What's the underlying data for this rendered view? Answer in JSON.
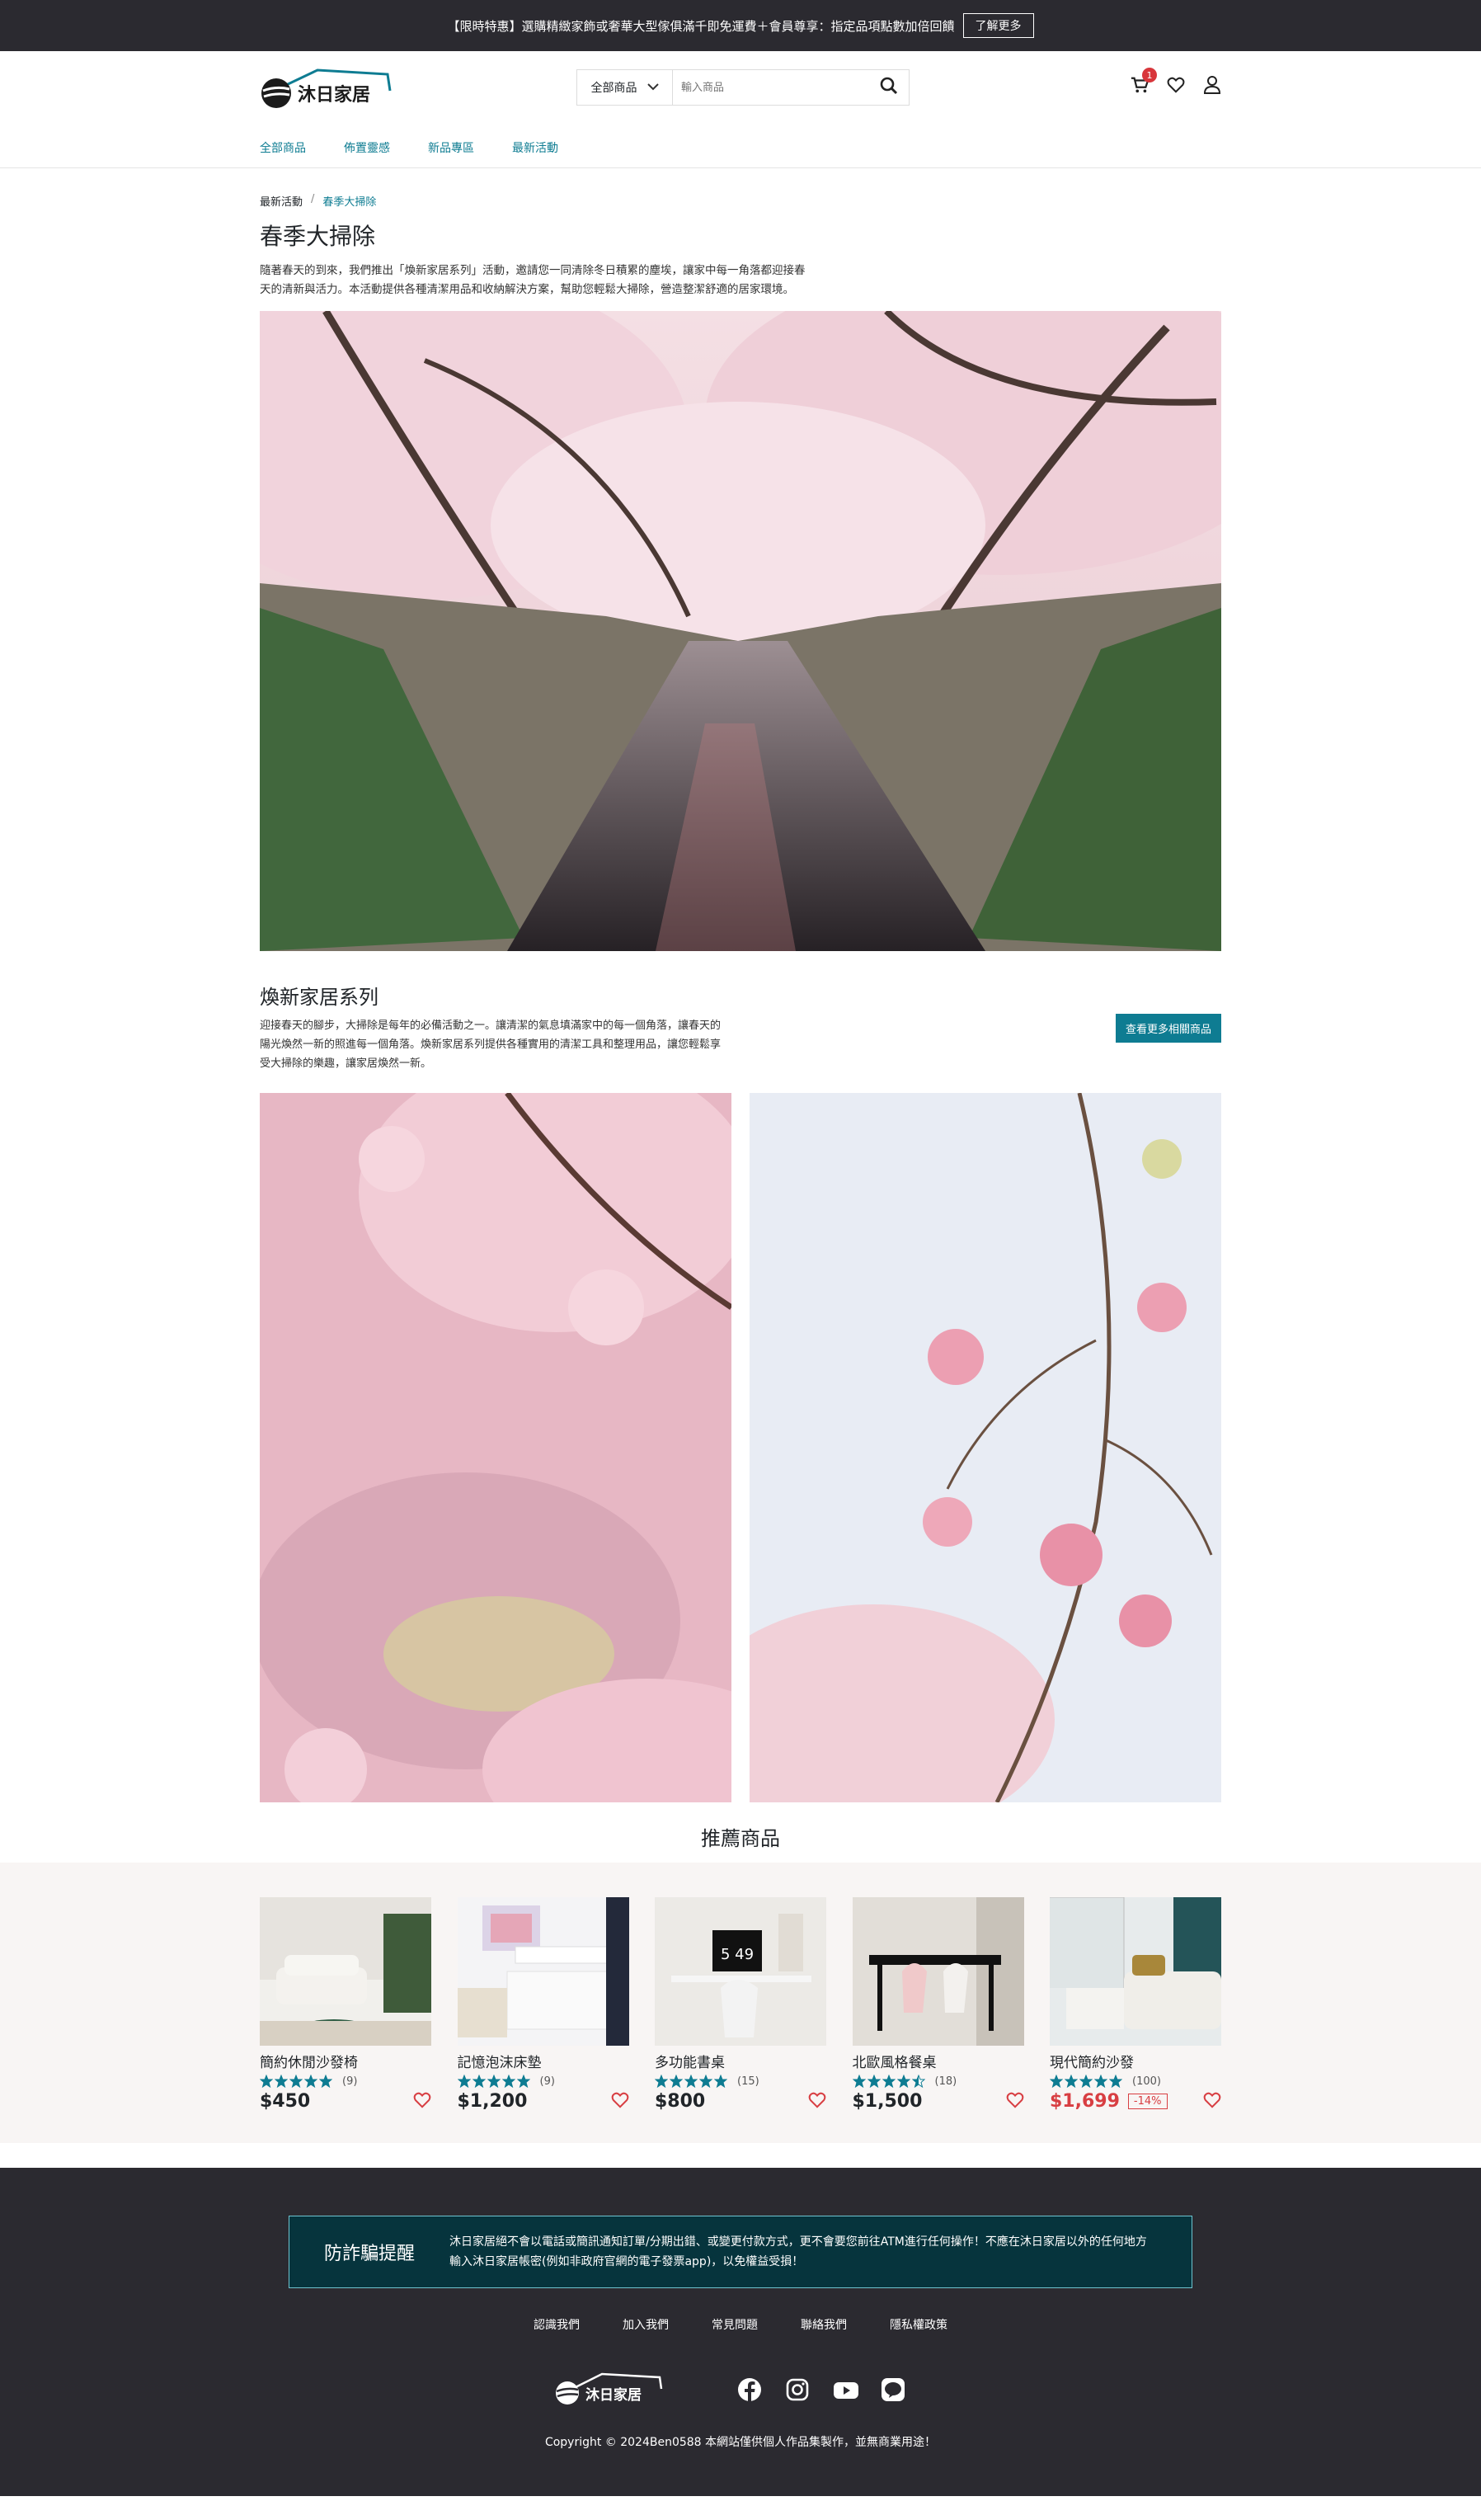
{
  "promo": {
    "text": "【限時特惠】選購精緻家飾或奢華大型傢俱滿千即免運費＋會員尊享：指定品項點數加倍回饋",
    "button": "了解更多"
  },
  "brand": {
    "name": "沐日家居",
    "accent": "#0e7c92"
  },
  "search": {
    "category": "全部商品",
    "placeholder": "輸入商品"
  },
  "cart": {
    "count": "1"
  },
  "nav": [
    "全部商品",
    "佈置靈感",
    "新品專區",
    "最新活動"
  ],
  "breadcrumb": [
    "最新活動",
    "/",
    "春季大掃除"
  ],
  "page": {
    "title": "春季大掃除",
    "description": "隨著春天的到來，我們推出「煥新家居系列」活動，邀請您一同清除冬日積累的塵埃，讓家中每一角落都迎接春天的清新與活力。本活動提供各種清潔用品和收納解決方案，幫助您輕鬆大掃除，營造整潔舒適的居家環境。"
  },
  "series": {
    "title": "煥新家居系列",
    "description": "迎接春天的腳步，大掃除是每年的必備活動之一。讓清潔的氣息填滿家中的每一個角落，讓春天的陽光煥然一新的照進每一個角落。煥新家居系列提供各種實用的清潔工具和整理用品，讓您輕鬆享受大掃除的樂趣，讓家居煥然一新。",
    "button": "查看更多相關商品"
  },
  "recommend": {
    "title": "推薦商品",
    "products": [
      {
        "name": "簡約休閒沙發椅",
        "stars": 5,
        "count": "(9)",
        "price": "$450",
        "sale": false,
        "discount": ""
      },
      {
        "name": "記憶泡沫床墊",
        "stars": 5,
        "count": "(9)",
        "price": "$1,200",
        "sale": false,
        "discount": ""
      },
      {
        "name": "多功能書桌",
        "stars": 5,
        "count": "(15)",
        "price": "$800",
        "sale": false,
        "discount": "",
        "clock": "5 49"
      },
      {
        "name": "北歐風格餐桌",
        "stars": 4.5,
        "count": "(18)",
        "price": "$1,500",
        "sale": false,
        "discount": ""
      },
      {
        "name": "現代簡約沙發",
        "stars": 5,
        "count": "(100)",
        "price": "$1,699",
        "sale": true,
        "discount": "-14%"
      }
    ]
  },
  "footer": {
    "fraud_label": "防詐騙提醒",
    "fraud_text": "沐日家居絕不會以電話或簡訊通知訂單/分期出錯、或變更付款方式，更不會要您前往ATM進行任何操作！不應在沐日家居以外的任何地方輸入沐日家居帳密(例如非政府官網的電子發票app)，以免權益受損！",
    "links": [
      "認識我們",
      "加入我們",
      "常見問題",
      "聯絡我們",
      "隱私權政策"
    ],
    "copyright": "Copyright © 2024Ben0588 本網站僅供個人作品集製作，並無商業用途！",
    "social": [
      "facebook-icon",
      "instagram-icon",
      "youtube-icon",
      "line-icon"
    ]
  }
}
